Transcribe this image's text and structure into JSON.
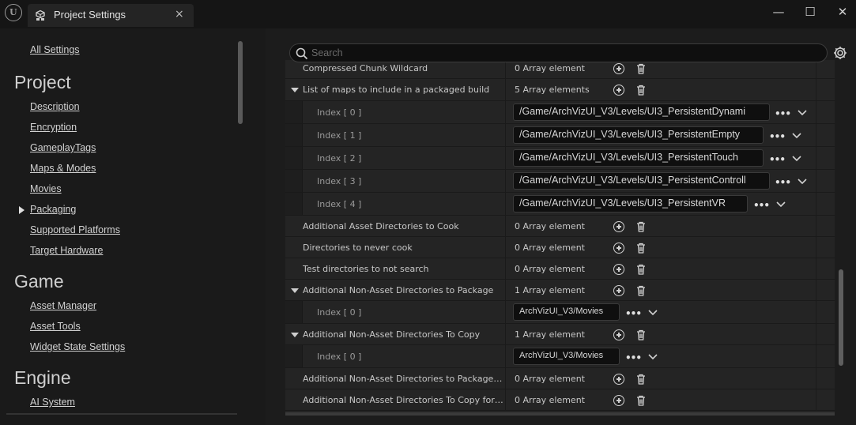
{
  "window": {
    "tab_title": "Project Settings",
    "close_tab": "×",
    "minimize": "—",
    "maximize": "☐",
    "close": "✕"
  },
  "sidebar": {
    "all_settings": "All Settings",
    "sections": [
      {
        "heading": "Project",
        "items": [
          "Description",
          "Encryption",
          "GameplayTags",
          "Maps & Modes",
          "Movies",
          "Packaging",
          "Supported Platforms",
          "Target Hardware"
        ]
      },
      {
        "heading": "Game",
        "items": [
          "Asset Manager",
          "Asset Tools",
          "Widget State Settings"
        ]
      },
      {
        "heading": "Engine",
        "items": [
          "AI System"
        ]
      }
    ],
    "selected": "Packaging"
  },
  "search": {
    "placeholder": "Search"
  },
  "rows": [
    {
      "label": "Compressed Chunk Wildcard",
      "value": "0 Array element"
    },
    {
      "label": "List of maps to include in a packaged build",
      "value": "5 Array elements"
    },
    {
      "label": "Index [ 0 ]",
      "path": "/Game/ArchVizUI_V3/Levels/UI3_PersistentDynami"
    },
    {
      "label": "Index [ 1 ]",
      "path": "/Game/ArchVizUI_V3/Levels/UI3_PersistentEmpty"
    },
    {
      "label": "Index [ 2 ]",
      "path": "/Game/ArchVizUI_V3/Levels/UI3_PersistentTouch"
    },
    {
      "label": "Index [ 3 ]",
      "path": "/Game/ArchVizUI_V3/Levels/UI3_PersistentControll"
    },
    {
      "label": "Index [ 4 ]",
      "path": "/Game/ArchVizUI_V3/Levels/UI3_PersistentVR"
    },
    {
      "label": "Additional Asset Directories to Cook",
      "value": "0 Array element"
    },
    {
      "label": "Directories to never cook",
      "value": "0 Array element"
    },
    {
      "label": "Test directories to not search",
      "value": "0 Array element"
    },
    {
      "label": "Additional Non-Asset Directories to Package",
      "value": "1 Array element"
    },
    {
      "label": "Index [ 0 ]",
      "path": "ArchVizUI_V3/Movies"
    },
    {
      "label": "Additional Non-Asset Directories To Copy",
      "value": "1 Array element"
    },
    {
      "label": "Index [ 0 ]",
      "path": "ArchVizUI_V3/Movies"
    },
    {
      "label": "Additional Non-Asset Directories to Package for...",
      "value": "0 Array element"
    },
    {
      "label": "Additional Non-Asset Directories To Copy for ded...",
      "value": "0 Array element"
    }
  ],
  "ellipsis": "•••",
  "colors": {
    "background": "#151515",
    "panel": "#1c1c1c",
    "row": "#242424",
    "field": "#0f0f0f"
  }
}
